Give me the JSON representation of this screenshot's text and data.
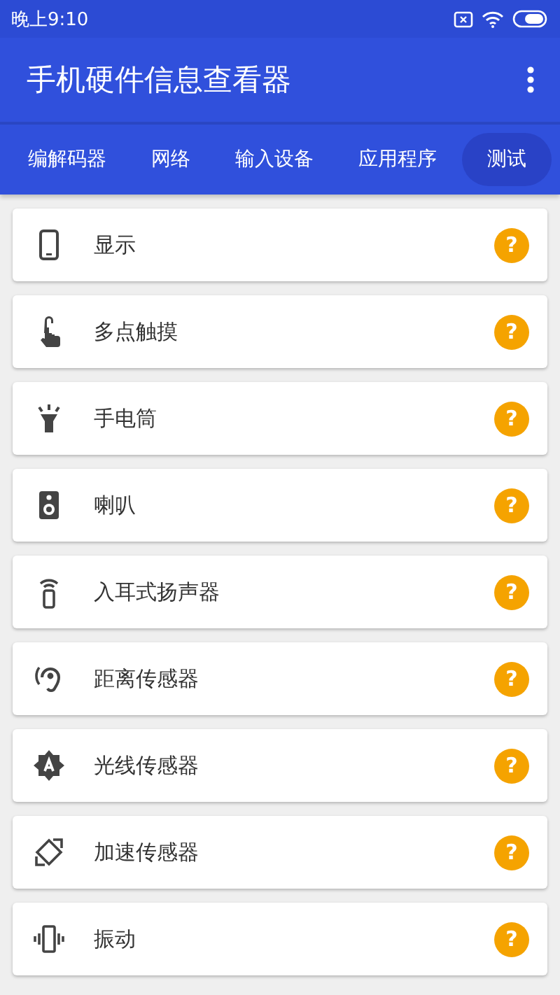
{
  "status_bar": {
    "time": "晚上9:10"
  },
  "app_bar": {
    "title": "手机硬件信息查看器"
  },
  "tabs": [
    {
      "label": "编解码器",
      "selected": false
    },
    {
      "label": "网络",
      "selected": false
    },
    {
      "label": "输入设备",
      "selected": false
    },
    {
      "label": "应用程序",
      "selected": false
    },
    {
      "label": "测试",
      "selected": true
    }
  ],
  "tests": [
    {
      "label": "显示",
      "badge": "?"
    },
    {
      "label": "多点触摸",
      "badge": "?"
    },
    {
      "label": "手电筒",
      "badge": "?"
    },
    {
      "label": "喇叭",
      "badge": "?"
    },
    {
      "label": "入耳式扬声器",
      "badge": "?"
    },
    {
      "label": "距离传感器",
      "badge": "?"
    },
    {
      "label": "光线传感器",
      "badge": "?"
    },
    {
      "label": "加速传感器",
      "badge": "?"
    },
    {
      "label": "振动",
      "badge": "?"
    }
  ]
}
